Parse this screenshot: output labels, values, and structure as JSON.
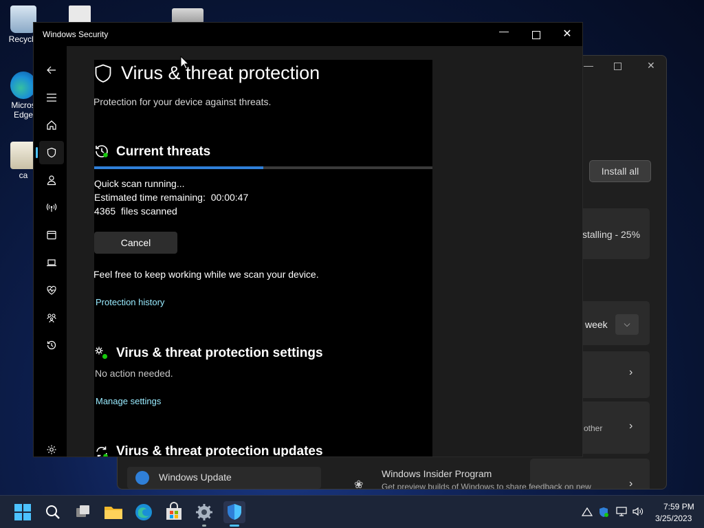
{
  "desktop": {
    "icons": [
      {
        "label": "Recycle"
      },
      {
        "label": "Micros Edge"
      },
      {
        "label": "ca"
      }
    ]
  },
  "background_window": {
    "install_all_label": "Install all",
    "installing_text": "stalling - 25%",
    "week_text": "week",
    "other_text": "other",
    "windows_update_label": "Windows Update",
    "insider_title": "Windows Insider Program",
    "insider_subtitle": "Get preview builds of Windows to share feedback on new"
  },
  "window": {
    "title": "Windows Security"
  },
  "page": {
    "title": "Virus & threat protection",
    "subtitle": "Protection for your device against threats."
  },
  "current_threats": {
    "heading": "Current threats",
    "progress_percent": 50,
    "status": "Quick scan running...",
    "eta_label": "Estimated time remaining:",
    "eta_value": "00:00:47",
    "files_count": "4365",
    "files_label": "files scanned",
    "cancel_label": "Cancel",
    "keep_working_text": "Feel free to keep working while we scan your device.",
    "history_link": "Protection history"
  },
  "settings_section": {
    "heading": "Virus & threat protection settings",
    "status": "No action needed.",
    "manage_link": "Manage settings"
  },
  "updates_section": {
    "heading": "Virus & threat protection updates"
  },
  "taskbar": {
    "clock_time": "7:59 PM",
    "clock_date": "3/25/2023"
  },
  "colors": {
    "accent": "#2f7fd8",
    "link": "#99ebff",
    "active_nav": "#4cc2ff"
  }
}
